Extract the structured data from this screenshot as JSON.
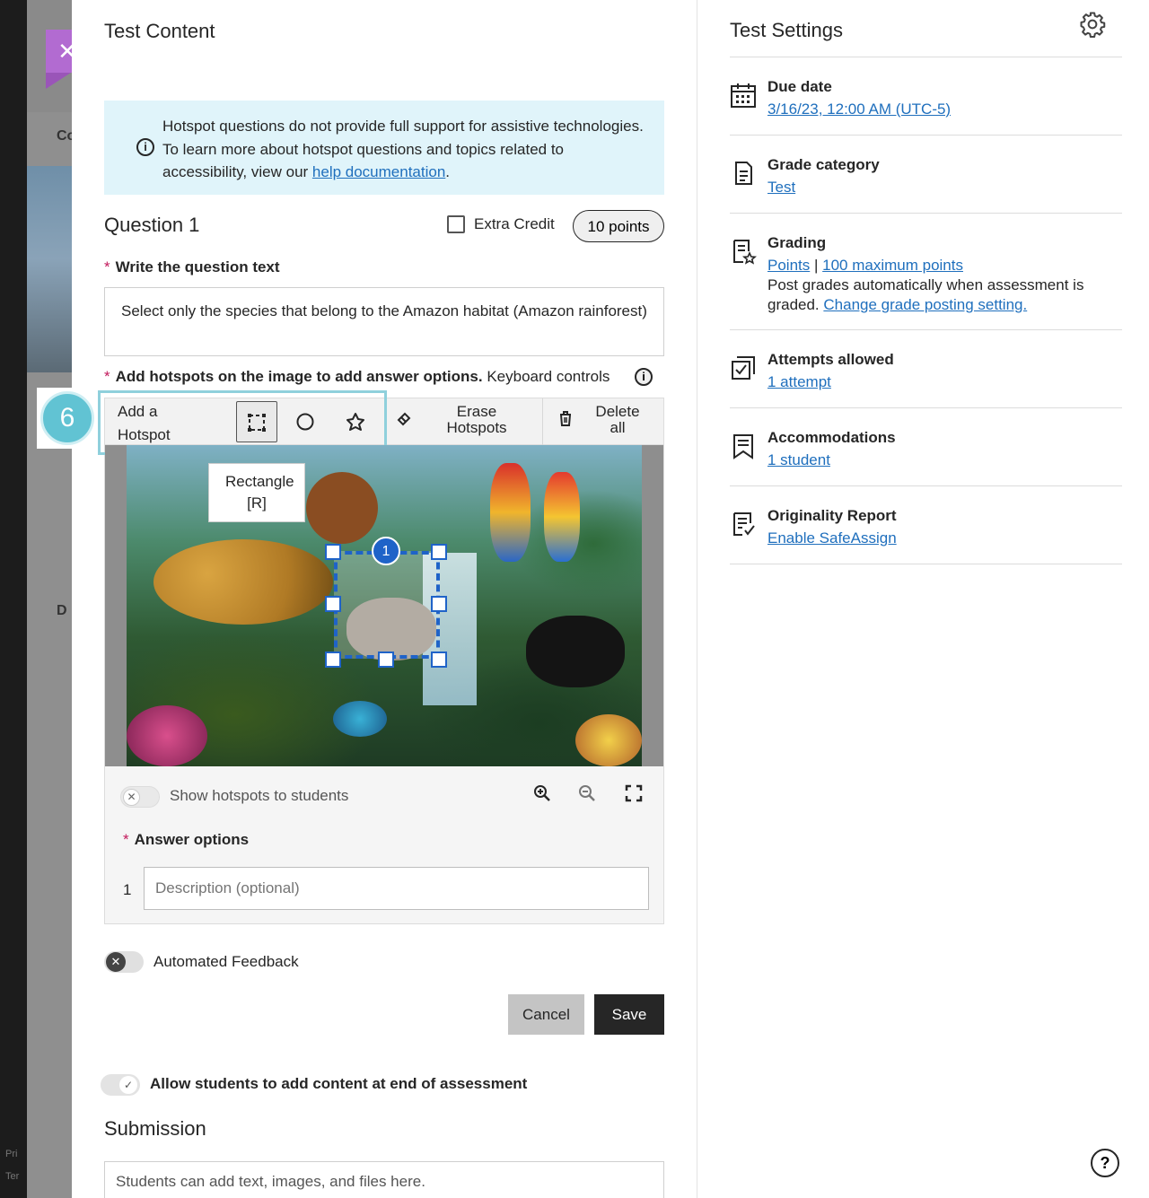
{
  "close_icon": "close-icon",
  "background_nav": {
    "tab_fragment": "Co",
    "d_fragment": "D",
    "footer_1": "Pri",
    "footer_2": "Ter"
  },
  "main": {
    "title": "Test Content",
    "info": {
      "text_before": "Hotspot questions do not provide full support for assistive technologies. To learn more about hotspot questions and topics related to accessibility, view our ",
      "link": "help documentation",
      "text_after": "."
    },
    "question": {
      "title": "Question 1",
      "extra_credit_label": "Extra Credit",
      "extra_credit_checked": false,
      "points": "10 points",
      "text_label": "Write the question text",
      "text_value": "Select only the species that belong to the Amazon habitat (Amazon rainforest)",
      "hotspot_label_bold": "Add hotspots on the image to add answer options.",
      "hotspot_label_normal": "Keyboard controls"
    },
    "toolbar": {
      "add_hotspot": "Add a Hotspot",
      "tools": [
        "rectangle-tool-icon",
        "circle-tool-icon",
        "polygon-tool-icon"
      ],
      "active_tool": "rectangle",
      "erase": "Erase Hotspots",
      "delete_all": "Delete all",
      "tooltip": "Rectangle [R]"
    },
    "hotspot": {
      "number": "1"
    },
    "show_hotspots_label": "Show hotspots to students",
    "show_hotspots_on": false,
    "answer_options_label": "Answer options",
    "answer_number": "1",
    "answer_placeholder": "Description (optional)",
    "automated_feedback_label": "Automated Feedback",
    "automated_feedback_on": false,
    "cancel": "Cancel",
    "save": "Save",
    "allow_students_label": "Allow students to add content at end of assessment",
    "allow_students_on": true,
    "submission_title": "Submission",
    "submission_placeholder": "Students can add text, images, and files here."
  },
  "step_badge": "6",
  "settings": {
    "title": "Test Settings",
    "due_date": {
      "label": "Due date",
      "value": "3/16/23, 12:00 AM (UTC-5)"
    },
    "grade_category": {
      "label": "Grade category",
      "value": "Test"
    },
    "grading": {
      "label": "Grading",
      "link1": "Points",
      "sep": "|",
      "link2": "100 maximum points",
      "text": "Post grades automatically when assessment is graded. ",
      "link3": "Change grade posting setting."
    },
    "attempts": {
      "label": "Attempts allowed",
      "value": "1 attempt"
    },
    "accommodations": {
      "label": "Accommodations",
      "value": "1 student"
    },
    "originality": {
      "label": "Originality Report",
      "value": "Enable SafeAssign"
    }
  },
  "colors": {
    "accent_purple": "#b26bd1",
    "link_blue": "#1f6fbd",
    "info_bg": "#e0f4fa",
    "step_teal": "#61c3d3",
    "hotspot_blue": "#1f63c8"
  }
}
